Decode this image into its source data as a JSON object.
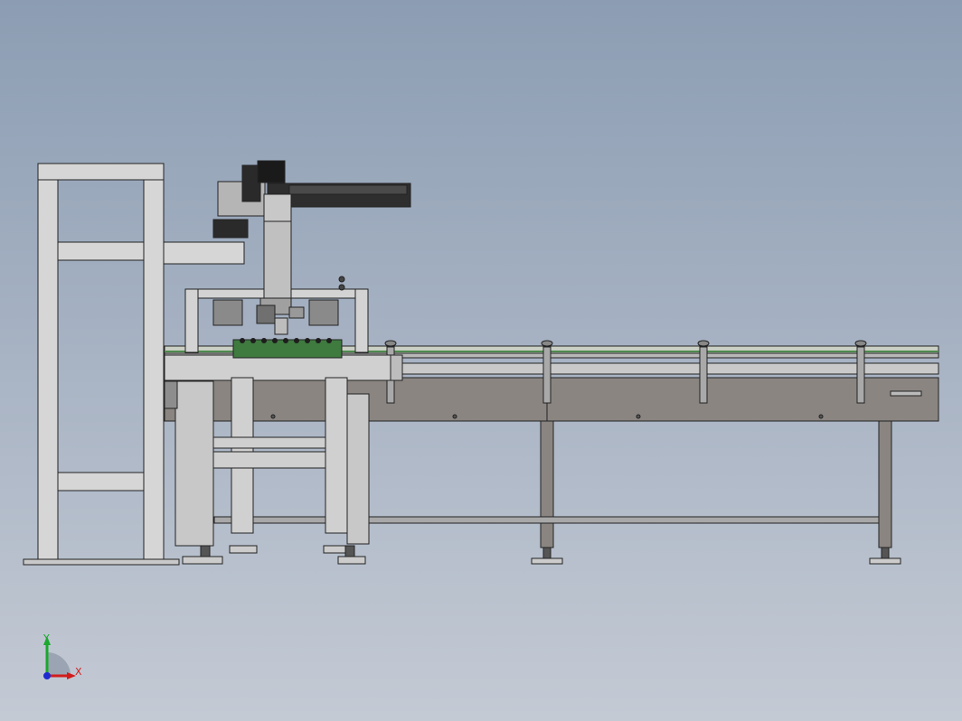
{
  "viewport": {
    "background_top": "#8c9db3",
    "background_bottom": "#c4cad4"
  },
  "model": {
    "description_icon": "machine-assembly",
    "frame_color": "#d4d4d4",
    "conveyor_color": "#8a8581",
    "fixture_color": "#3f7a3f",
    "actuator_color": "#2a2a2a"
  },
  "triad": {
    "x_label": "X",
    "y_label": "Y",
    "x_color": "#d21c1c",
    "y_color": "#1aa82e",
    "z_color": "#1d2ad0"
  }
}
